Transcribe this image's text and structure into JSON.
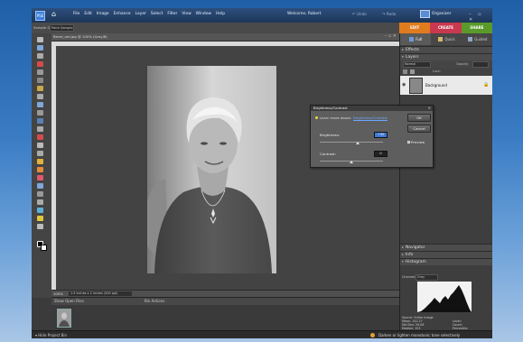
{
  "app": {
    "menu": [
      "File",
      "Edit",
      "Image",
      "Enhance",
      "Layer",
      "Select",
      "Filter",
      "View",
      "Window",
      "Help"
    ],
    "welcome": "Welcome, Robert",
    "undo_label": "Undo",
    "redo_label": "Redo",
    "organizer_label": "Organizer",
    "logo_text": "PSE"
  },
  "options_bar": {
    "title": "Sample Grid",
    "preset_value": "Point Sample"
  },
  "mode_tabs": [
    {
      "label": "EDIT",
      "color": "#e07b1e"
    },
    {
      "label": "CREATE",
      "color": "#c8384e"
    },
    {
      "label": "SHARE",
      "color": "#5a9a2b"
    }
  ],
  "edit_subtabs": [
    "Full",
    "Quick",
    "Guided"
  ],
  "document": {
    "tab_title": "Bevel_red.jpg @ 100% (Gray/8)",
    "zoom": "100%",
    "status_info": "1.5 inches x 2 inches (300 ppi)"
  },
  "project_bin": {
    "show_label": "Show Open Files",
    "actions_label": "Bin Actions"
  },
  "panels": {
    "effects": "Effects",
    "layers": "Layers",
    "blend_mode": "Normal",
    "opacity_label": "Opacity:",
    "lock_label": "Lock:",
    "layer_name": "Background",
    "navigator": "Navigator",
    "info": "Info",
    "histogram": "Histogram",
    "channel_label": "Channel:",
    "channel_value": "Gray",
    "source_label": "Source:",
    "source_value": "Entire Image",
    "stats": [
      {
        "k": "Mean:",
        "v": "142.27"
      },
      {
        "k": "Std Dev:",
        "v": "59.08"
      },
      {
        "k": "Median:",
        "v": "153"
      }
    ],
    "stats2": [
      "Level:",
      "Count:",
      "Percentile:"
    ]
  },
  "dialog": {
    "title": "Brightness/Contrast",
    "learn_text": "Learn more about:",
    "learn_link": "Brightness/Contrast",
    "brightness_label": "Brightness:",
    "brightness_value": "+30",
    "brightness_fraction": 0.6,
    "contrast_label": "Contrast:",
    "contrast_value": "0",
    "contrast_fraction": 0.5,
    "ok_label": "OK",
    "cancel_label": "Cancel",
    "preview_label": "Preview",
    "preview_checked": true
  },
  "bottom_bar": {
    "hide_label": "Hide Project Bin",
    "status_message": "Darken or lighten monotonic tone selectively"
  }
}
